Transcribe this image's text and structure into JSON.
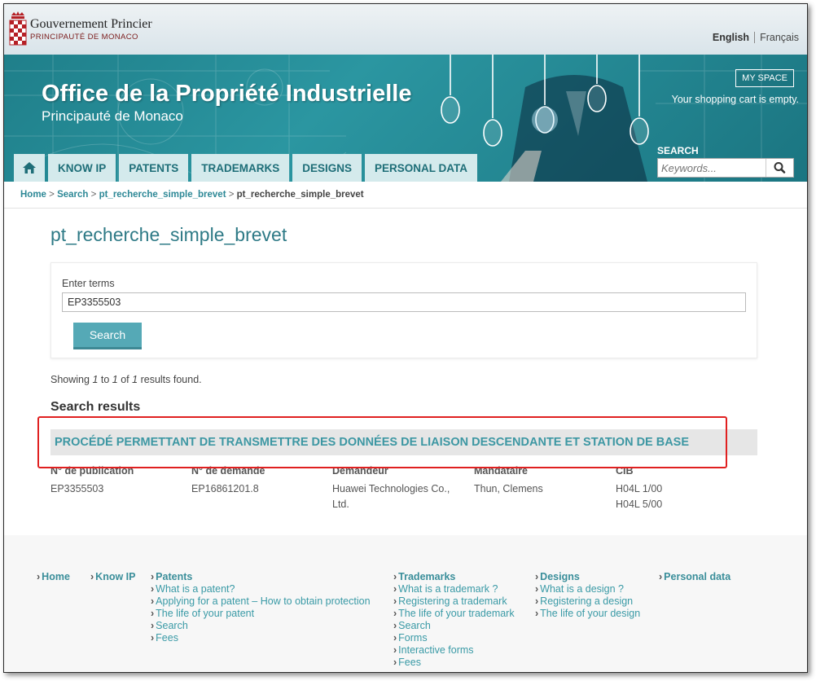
{
  "header": {
    "gov_name": "Gouvernement Princier",
    "gov_sub": "PRINCIPAUTÉ DE MONACO",
    "lang_en": "English",
    "lang_fr": "Français"
  },
  "banner": {
    "title": "Office de la Propriété Industrielle",
    "subtitle": "Principauté de Monaco",
    "my_space": "MY SPACE",
    "cart": "Your shopping cart is empty.",
    "search_label": "SEARCH",
    "search_placeholder": "Keywords..."
  },
  "nav": {
    "home_icon": "home-icon",
    "items": [
      "KNOW IP",
      "PATENTS",
      "TRADEMARKS",
      "DESIGNS",
      "PERSONAL DATA"
    ]
  },
  "breadcrumb": {
    "home": "Home",
    "search": "Search",
    "link": "pt_recherche_simple_brevet",
    "current": "pt_recherche_simple_brevet",
    "sep": ">"
  },
  "page": {
    "title": "pt_recherche_simple_brevet",
    "terms_label": "Enter terms",
    "terms_value": "EP3355503",
    "search_button": "Search",
    "count_pre": "Showing",
    "count_from": "1",
    "count_to_word": "to",
    "count_to": "1",
    "count_of_word": "of",
    "count_total": "1",
    "count_post": "results found.",
    "results_heading": "Search results"
  },
  "result": {
    "title": "PROCÉDÉ PERMETTANT DE TRANSMETTRE DES DONNÉES DE LIAISON DESCENDANTE ET STATION DE BASE",
    "columns": [
      {
        "head": "N° de publication",
        "values": [
          "EP3355503"
        ]
      },
      {
        "head": "N° de demande",
        "values": [
          "EP16861201.8"
        ]
      },
      {
        "head": "Demandeur",
        "values": [
          "Huawei Technologies Co.,",
          "Ltd."
        ]
      },
      {
        "head": "Mandataire",
        "values": [
          "Thun, Clemens"
        ]
      },
      {
        "head": "CIB",
        "values": [
          "H04L 1/00",
          "H04L 5/00"
        ]
      }
    ]
  },
  "footer": {
    "home": "Home",
    "know_ip": "Know IP",
    "patents": {
      "head": "Patents",
      "items": [
        "What is a patent?",
        "Applying for a patent – How to obtain protection",
        "The life of your patent",
        "Search",
        "Fees"
      ]
    },
    "trademarks": {
      "head": "Trademarks",
      "items": [
        "What is a trademark ?",
        "Registering a trademark",
        "The life of your trademark",
        "Search",
        "Forms",
        "Interactive forms",
        "Fees"
      ]
    },
    "designs": {
      "head": "Designs",
      "items": [
        "What is a design ?",
        "Registering a design",
        "The life of your design"
      ]
    },
    "personal_data": "Personal data"
  },
  "colors": {
    "accent": "#2e7a86",
    "link": "#3a9aa6",
    "highlight": "#e02020"
  }
}
